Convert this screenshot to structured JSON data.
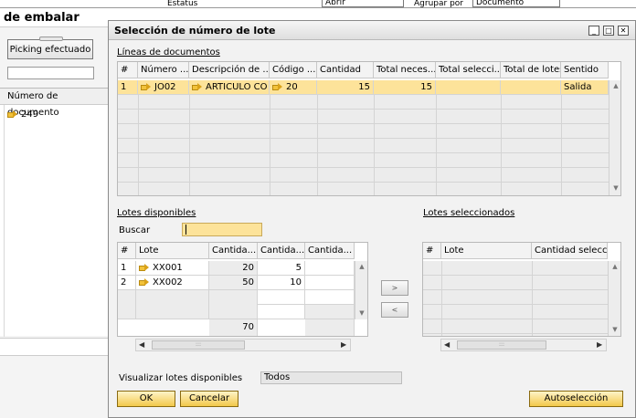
{
  "background": {
    "top_fields": {
      "estatus_label": "Estatus",
      "abrir_value": "Abrir",
      "agrupar_label": "Agrupar por",
      "agrupar_value": "Documento"
    },
    "title": "de embalar",
    "picking_button": "Picking efectuado",
    "grid_header": "Número de documento",
    "grid_row_value": "249"
  },
  "dialog": {
    "title": "Selección de número de lote",
    "window_buttons": [
      "minimize-icon",
      "maximize-icon",
      "close-icon"
    ],
    "doc_lines": {
      "section_label": "Líneas de documentos",
      "columns": [
        "#",
        "Número ...",
        "Descripción de ...",
        "Código ...",
        "Cantidad",
        "Total neces...",
        "Total selecci...",
        "Total de lotes",
        "Sentido"
      ],
      "rows": [
        {
          "num": "1",
          "numero": "JO02",
          "descripcion": "ARTICULO CO",
          "codigo": "20",
          "cantidad": "15",
          "total_necesario": "15",
          "total_seleccionado": "",
          "total_lotes": "",
          "sentido": "Salida"
        }
      ]
    },
    "available": {
      "section_label": "Lotes disponibles",
      "search_label": "Buscar",
      "search_value": "",
      "columns": [
        "#",
        "Lote",
        "Cantida...",
        "Cantida...",
        "Cantida..."
      ],
      "rows": [
        {
          "num": "1",
          "lote": "XX001",
          "c1": "20",
          "c2": "5",
          "c3": ""
        },
        {
          "num": "2",
          "lote": "XX002",
          "c1": "50",
          "c2": "10",
          "c3": ""
        }
      ],
      "total": "70"
    },
    "move_buttons": {
      "right": ">",
      "left": "<"
    },
    "selected": {
      "section_label": "Lotes seleccionados",
      "columns": [
        "#",
        "Lote",
        "Cantidad selecc..."
      ]
    },
    "visualize": {
      "label": "Visualizar lotes disponibles",
      "value": "Todos"
    },
    "buttons": {
      "ok": "OK",
      "cancel": "Cancelar",
      "auto": "Autoselección"
    },
    "accent_color": "#fde39a",
    "button_color": "#f2c84a"
  }
}
